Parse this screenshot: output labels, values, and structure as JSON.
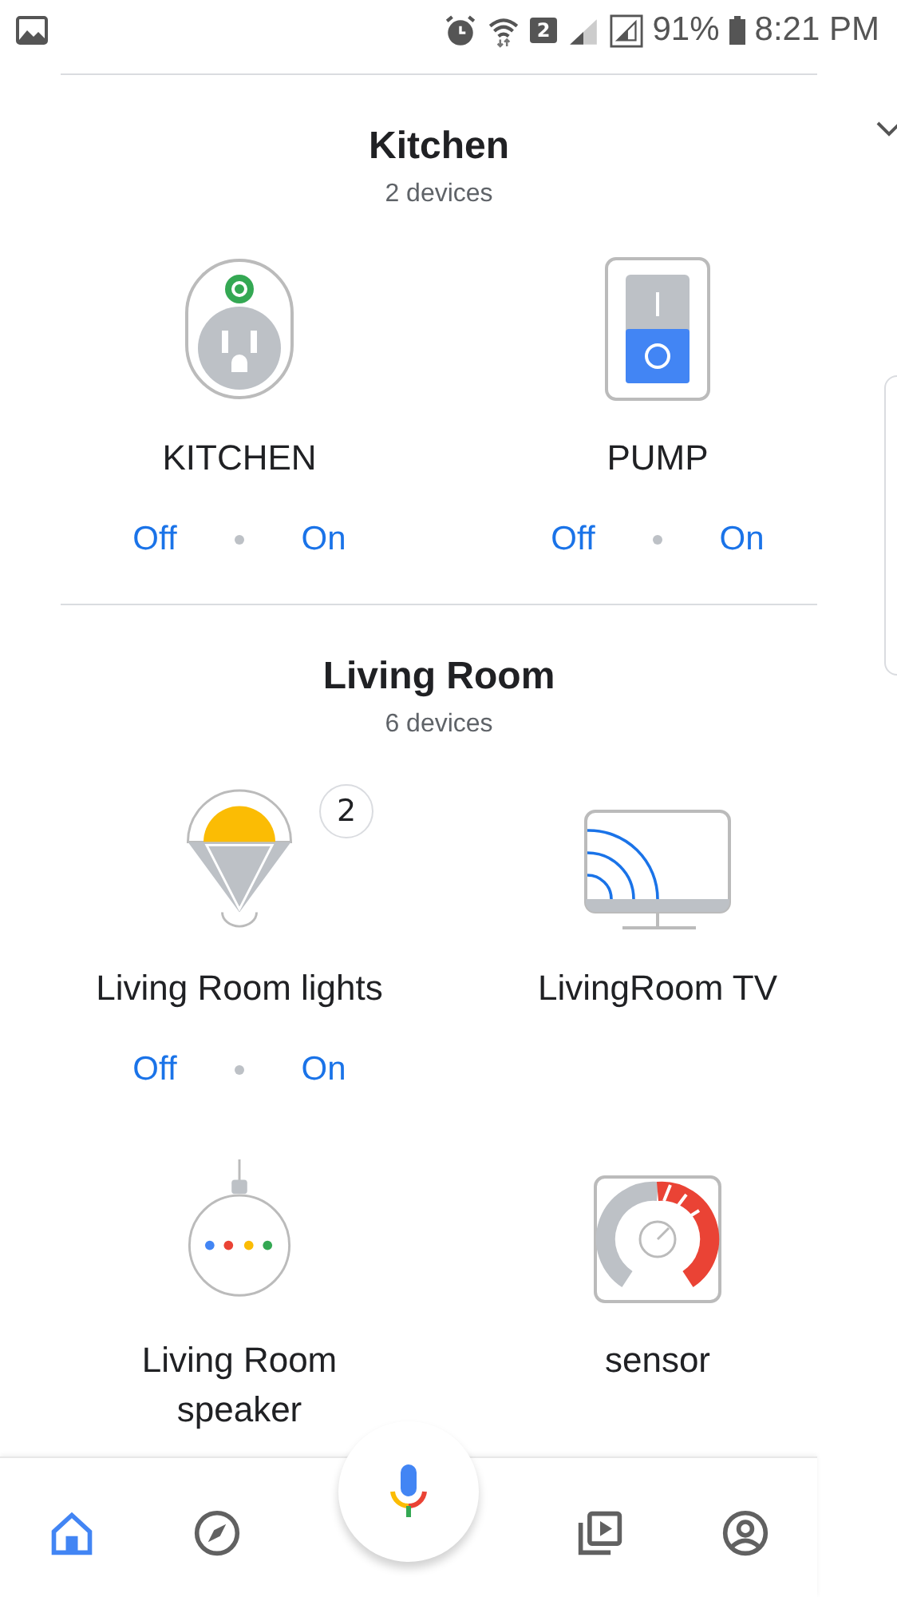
{
  "status_bar": {
    "sim": "2",
    "battery": "91%",
    "time": "8:21 PM"
  },
  "rooms": [
    {
      "name": "Kitchen",
      "count": "2 devices",
      "devices": [
        {
          "name": "KITCHEN",
          "kind": "outlet",
          "controls": {
            "off": "Off",
            "on": "On"
          }
        },
        {
          "name": "PUMP",
          "kind": "switch",
          "controls": {
            "off": "Off",
            "on": "On"
          }
        }
      ]
    },
    {
      "name": "Living Room",
      "count": "6 devices",
      "devices": [
        {
          "name": "Living Room lights",
          "kind": "light",
          "badge": "2",
          "controls": {
            "off": "Off",
            "on": "On"
          }
        },
        {
          "name": "LivingRoom TV",
          "kind": "tv"
        },
        {
          "name": "Living Room speaker",
          "kind": "speaker"
        },
        {
          "name": "sensor",
          "kind": "sensor"
        }
      ]
    }
  ],
  "nav": [
    {
      "kind": "home",
      "selected": true
    },
    {
      "kind": "explore",
      "selected": false
    },
    {
      "kind": "mic"
    },
    {
      "kind": "media",
      "selected": false
    },
    {
      "kind": "account",
      "selected": false
    }
  ]
}
